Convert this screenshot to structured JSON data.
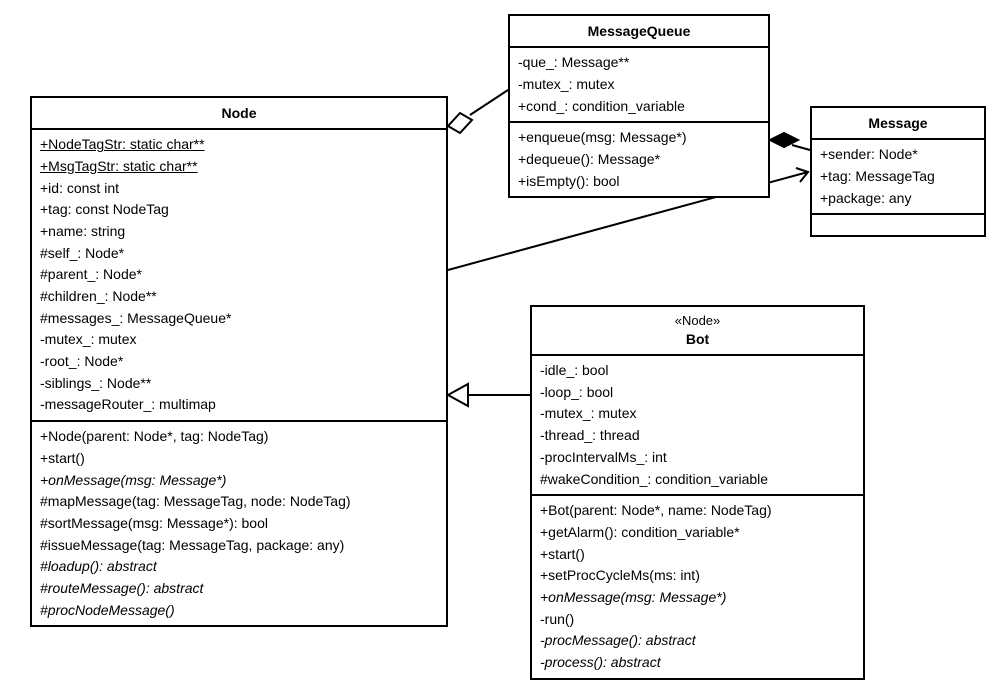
{
  "diagram_type": "UML Class Diagram",
  "classes": {
    "node": {
      "name": "Node",
      "attributes": [
        {
          "text": "+NodeTagStr: static char**",
          "static": true
        },
        {
          "text": "+MsgTagStr: static char**",
          "static": true
        },
        {
          "text": "+id: const int"
        },
        {
          "text": "+tag: const NodeTag"
        },
        {
          "text": "+name: string"
        },
        {
          "text": "#self_: Node*"
        },
        {
          "text": "#parent_: Node*"
        },
        {
          "text": "#children_: Node**"
        },
        {
          "text": "#messages_: MessageQueue*"
        },
        {
          "text": "-mutex_: mutex"
        },
        {
          "text": "-root_: Node*"
        },
        {
          "text": "-siblings_: Node**"
        },
        {
          "text": "-messageRouter_: multimap"
        }
      ],
      "operations": [
        {
          "text": "+Node(parent: Node*, tag: NodeTag)"
        },
        {
          "text": "+start()"
        },
        {
          "text": "+onMessage(msg: Message*)",
          "abstract": true
        },
        {
          "text": "#mapMessage(tag: MessageTag, node: NodeTag)"
        },
        {
          "text": "#sortMessage(msg: Message*): bool"
        },
        {
          "text": "#issueMessage(tag: MessageTag, package: any)"
        },
        {
          "text": "#loadup(): abstract",
          "abstract": true
        },
        {
          "text": "#routeMessage(): abstract",
          "abstract": true
        },
        {
          "text": "#procNodeMessage()",
          "abstract": true
        }
      ]
    },
    "message_queue": {
      "name": "MessageQueue",
      "attributes": [
        {
          "text": "-que_: Message**"
        },
        {
          "text": "-mutex_: mutex"
        },
        {
          "text": "+cond_: condition_variable"
        }
      ],
      "operations": [
        {
          "text": "+enqueue(msg: Message*)"
        },
        {
          "text": "+dequeue(): Message*"
        },
        {
          "text": "+isEmpty(): bool"
        }
      ]
    },
    "message": {
      "name": "Message",
      "attributes": [
        {
          "text": "+sender: Node*"
        },
        {
          "text": "+tag: MessageTag"
        },
        {
          "text": "+package: any"
        }
      ],
      "operations": []
    },
    "bot": {
      "stereotype": "«Node»",
      "name": "Bot",
      "attributes": [
        {
          "text": "-idle_: bool"
        },
        {
          "text": "-loop_: bool"
        },
        {
          "text": "-mutex_: mutex"
        },
        {
          "text": "-thread_: thread"
        },
        {
          "text": "-procIntervalMs_: int"
        },
        {
          "text": "#wakeCondition_: condition_variable"
        }
      ],
      "operations": [
        {
          "text": "+Bot(parent: Node*, name: NodeTag)"
        },
        {
          "text": "+getAlarm(): condition_variable*"
        },
        {
          "text": "+start()"
        },
        {
          "text": "+setProcCycleMs(ms: int)"
        },
        {
          "text": "+onMessage(msg: Message*)",
          "abstract": true
        },
        {
          "text": "-run()"
        },
        {
          "text": "-procMessage(): abstract",
          "abstract": true
        },
        {
          "text": "-process(): abstract",
          "abstract": true
        }
      ]
    }
  },
  "relationships": [
    {
      "from": "Node",
      "to": "MessageQueue",
      "type": "aggregation",
      "end": "open-diamond"
    },
    {
      "from": "MessageQueue",
      "to": "Message",
      "type": "composition",
      "end": "filled-diamond"
    },
    {
      "from": "Node",
      "to": "Message",
      "type": "association",
      "end": "open-arrow"
    },
    {
      "from": "Bot",
      "to": "Node",
      "type": "generalization",
      "end": "open-triangle"
    }
  ]
}
